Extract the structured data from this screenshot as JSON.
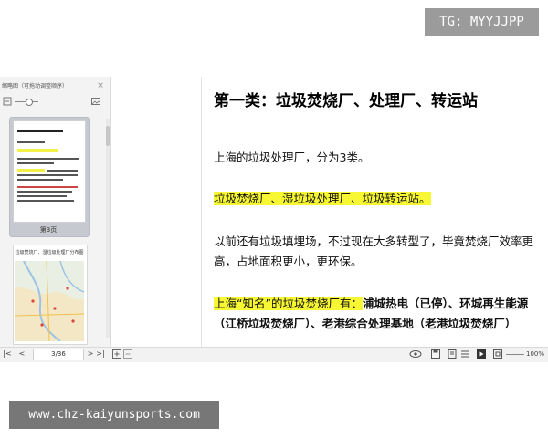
{
  "overlay": {
    "tag": "TG: MYYJJPP",
    "watermark": "www.chz-kaiyunsports.com"
  },
  "sidebar": {
    "title": "缩略图（可拖动调整顺序）",
    "close": "×",
    "thumbnail_1_label": "第3页",
    "thumbnail_2_title": "垃圾焚烧厂、湿垃圾处理厂分布图"
  },
  "document": {
    "title": "第一类：垃圾焚烧厂、处理厂、转运站",
    "p1": "上海的垃圾处理厂，分为3类。",
    "p2": "垃圾焚烧厂、湿垃圾处理厂、垃圾转运站。",
    "p3": "以前还有垃圾填埋场，不过现在大多转型了，毕竟焚烧厂效率更高，占地面积更小，更环保。",
    "p4_highlight": "上海“知名”的垃圾焚烧厂有：",
    "p4_rest": "浦城热电（已停）、环城再生能源（江桥垃圾焚烧厂）、老港综合处理基地（老港垃圾焚烧厂）"
  },
  "statusbar": {
    "first": "|<",
    "prev": "<",
    "page": "3/36",
    "next": ">",
    "last": ">|",
    "zoom": "100%"
  },
  "colors": {
    "highlight": "#f7f733",
    "sidebar_bg": "#f3f3f3",
    "statusbar_bg": "#f2f2f2"
  }
}
